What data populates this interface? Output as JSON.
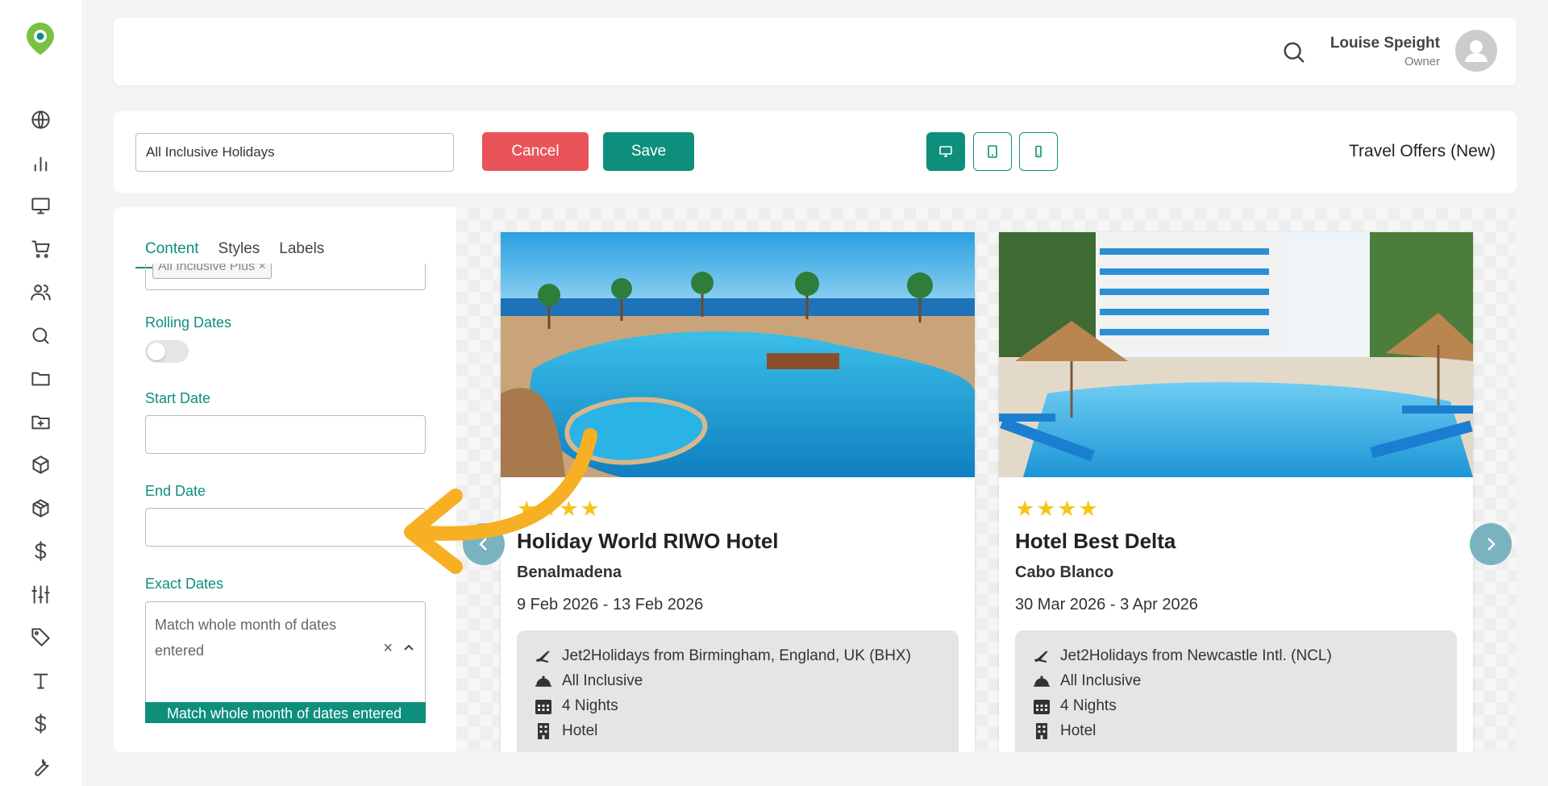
{
  "user": {
    "name": "Louise Speight",
    "role": "Owner"
  },
  "toolbar": {
    "name_value": "All Inclusive Holidays",
    "cancel_label": "Cancel",
    "save_label": "Save",
    "page_title": "Travel Offers (New)"
  },
  "panel": {
    "tabs": [
      {
        "label": "Content"
      },
      {
        "label": "Styles"
      },
      {
        "label": "Labels"
      }
    ],
    "partial_chip": "All Inclusive Plus ×",
    "rolling_dates_label": "Rolling Dates",
    "rolling_dates_on": false,
    "start_date_label": "Start Date",
    "end_date_label": "End Date",
    "exact_dates_label": "Exact Dates",
    "exact_dates_value": "Match whole month of dates entered",
    "exact_dates_option": "Match whole month of dates entered"
  },
  "cards": [
    {
      "stars": "★★★★",
      "hotel": "Holiday World RIWO Hotel",
      "resort": "Benalmadena",
      "dates": "9 Feb 2026 - 13 Feb 2026",
      "flight": "Jet2Holidays from Birmingham, England, UK (BHX)",
      "board": "All Inclusive",
      "nights": "4 Nights",
      "type": "Hotel"
    },
    {
      "stars": "★★★★",
      "hotel": "Hotel Best Delta",
      "resort": "Cabo Blanco",
      "dates": "30 Mar 2026 - 3 Apr 2026",
      "flight": "Jet2Holidays from Newcastle Intl. (NCL)",
      "board": "All Inclusive",
      "nights": "4 Nights",
      "type": "Hotel"
    }
  ],
  "colors": {
    "accent": "#0e8f7b",
    "cancel": "#e9545a",
    "star": "#f5c518",
    "annotation_arrow": "#f7b023"
  }
}
